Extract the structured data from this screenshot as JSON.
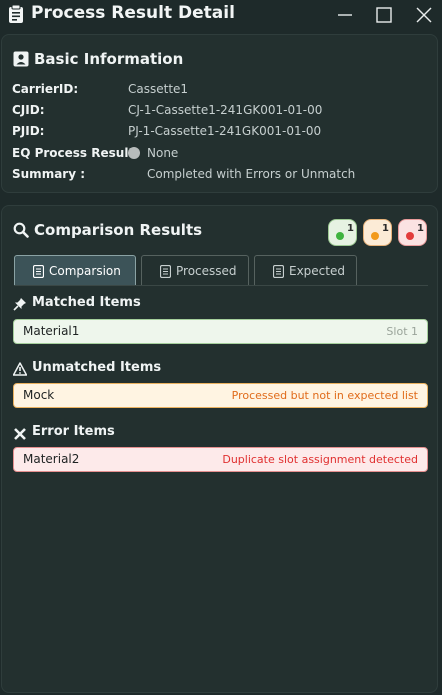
{
  "window": {
    "title": "Process Result Detail"
  },
  "basic": {
    "heading": "Basic Information",
    "fields": [
      {
        "label": "CarrierID:",
        "value": "Cassette1"
      },
      {
        "label": "CJID:",
        "value": "CJ-1-Cassette1-241GK001-01-00"
      },
      {
        "label": "PJID:",
        "value": "PJ-1-Cassette1-241GK001-01-00"
      },
      {
        "label": "EQ Process Result:",
        "value": "None"
      },
      {
        "label": "Summary :",
        "value": "Completed with Errors or Unmatch"
      }
    ]
  },
  "comparison": {
    "heading": "Comparison Results",
    "badges": [
      {
        "count": "1",
        "color": "#3fb33f"
      },
      {
        "count": "1",
        "color": "#f29a1c"
      },
      {
        "count": "1",
        "color": "#e23b3b"
      }
    ],
    "tabs": [
      {
        "label": "Comparsion"
      },
      {
        "label": "Processed"
      },
      {
        "label": "Expected"
      }
    ],
    "groups": {
      "matched": {
        "heading": "Matched Items",
        "items": [
          {
            "name": "Material1",
            "note": "Slot 1"
          }
        ]
      },
      "unmatched": {
        "heading": "Unmatched Items",
        "items": [
          {
            "name": "Mock",
            "note": "Processed but not in expected list"
          }
        ]
      },
      "errors": {
        "heading": "Error Items",
        "items": [
          {
            "name": "Material2",
            "note": "Duplicate slot assignment detected"
          }
        ]
      }
    }
  },
  "icons": {
    "title": "clipboard-icon",
    "basic": "id-card-icon",
    "comparison": "search-icon",
    "matched": "pin-icon",
    "unmatched": "warning-icon",
    "errors": "x-icon"
  }
}
